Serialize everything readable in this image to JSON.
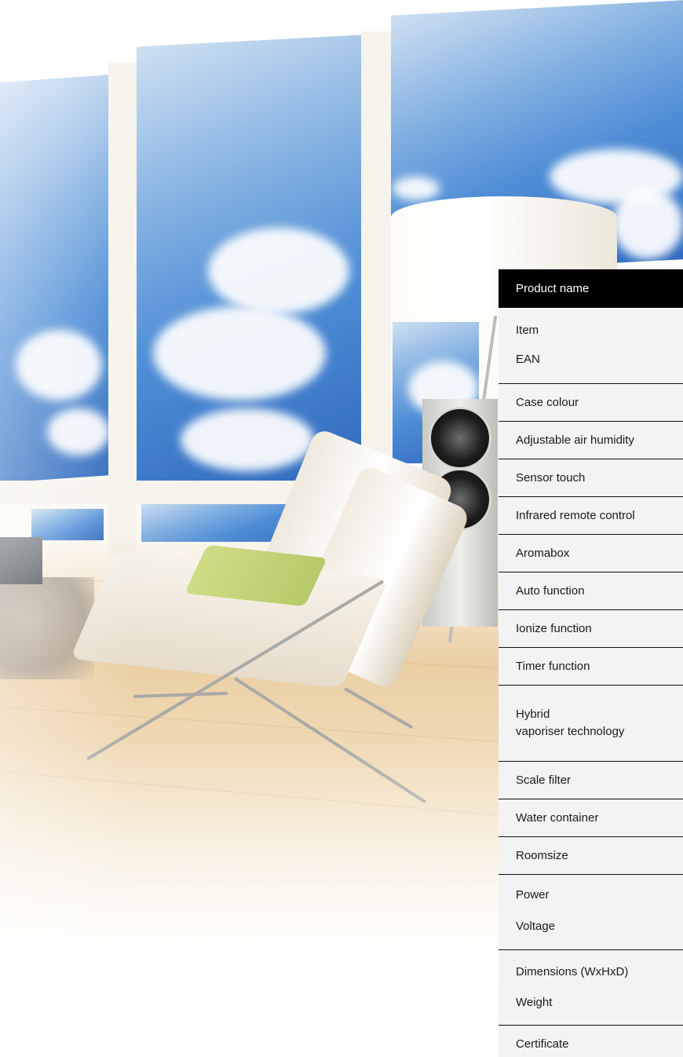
{
  "table": {
    "header": "Product name",
    "rows": [
      {
        "lines": [
          "Item",
          "EAN"
        ]
      },
      {
        "lines": [
          "Case colour"
        ]
      },
      {
        "lines": [
          "Adjustable air humidity"
        ]
      },
      {
        "lines": [
          "Sensor touch"
        ]
      },
      {
        "lines": [
          "Infrared remote control"
        ]
      },
      {
        "lines": [
          "Aromabox"
        ]
      },
      {
        "lines": [
          "Auto function"
        ]
      },
      {
        "lines": [
          "Ionize function"
        ]
      },
      {
        "lines": [
          "Timer function"
        ]
      },
      {
        "lines": [
          "Hybrid",
          "vaporiser technology"
        ]
      },
      {
        "lines": [
          "Scale filter"
        ]
      },
      {
        "lines": [
          "Water container"
        ]
      },
      {
        "lines": [
          "Roomsize"
        ]
      },
      {
        "lines": [
          "Power",
          "Voltage"
        ]
      },
      {
        "lines": [
          "Dimensions (WxHxD)",
          "Weight"
        ]
      },
      {
        "lines": [
          "Certificate"
        ]
      }
    ]
  },
  "colors": {
    "header_bg": "#000000",
    "header_text": "#ffffff",
    "table_bg": "#f3f3f3",
    "divider": "#111111"
  }
}
